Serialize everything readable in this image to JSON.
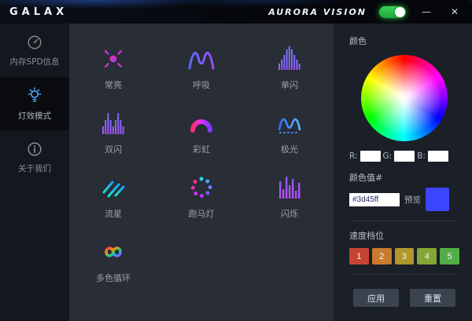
{
  "titlebar": {
    "logo": "GALAX",
    "app_title": "AURORA VISION",
    "minimize_label": "—",
    "close_label": "✕"
  },
  "sidebar": {
    "items": [
      {
        "label": "内存SPD信息"
      },
      {
        "label": "灯效模式"
      },
      {
        "label": "关于我们"
      }
    ]
  },
  "modes": [
    {
      "label": "常亮"
    },
    {
      "label": "呼吸"
    },
    {
      "label": "单闪"
    },
    {
      "label": "双闪"
    },
    {
      "label": "彩虹"
    },
    {
      "label": "极光"
    },
    {
      "label": "流星"
    },
    {
      "label": "跑马灯"
    },
    {
      "label": "闪烁"
    },
    {
      "label": "多色循环"
    }
  ],
  "color_panel": {
    "section_title": "颜色",
    "r_label": "R:",
    "g_label": "G:",
    "b_label": "B:",
    "hex_label": "颜色值#",
    "hex_value": "#3d45ff",
    "preview_label": "预览",
    "preview_color": "#3d45ff",
    "speed_title": "速度档位",
    "speed_levels": [
      {
        "value": "1",
        "color": "#c44434"
      },
      {
        "value": "2",
        "color": "#c97a2e"
      },
      {
        "value": "3",
        "color": "#b1952f"
      },
      {
        "value": "4",
        "color": "#85a636"
      },
      {
        "value": "5",
        "color": "#52ad47"
      }
    ],
    "apply_label": "应用",
    "reset_label": "重置"
  }
}
